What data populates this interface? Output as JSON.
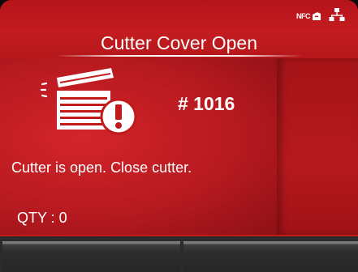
{
  "header": {
    "title": "Cutter Cover Open",
    "status_icons": [
      "nfc-icon",
      "network-icon"
    ],
    "nfc_label": "NFC"
  },
  "error": {
    "code": "# 1016",
    "icon": "cutter-cover-open-icon",
    "message": "Cutter is open. Close cutter.",
    "qty": "QTY : 0"
  },
  "softkeys": {
    "left_label": "",
    "right_label": ""
  },
  "colors": {
    "background": "#c11a1a",
    "text": "#ffffff",
    "softkey": "#2b2b2b"
  }
}
